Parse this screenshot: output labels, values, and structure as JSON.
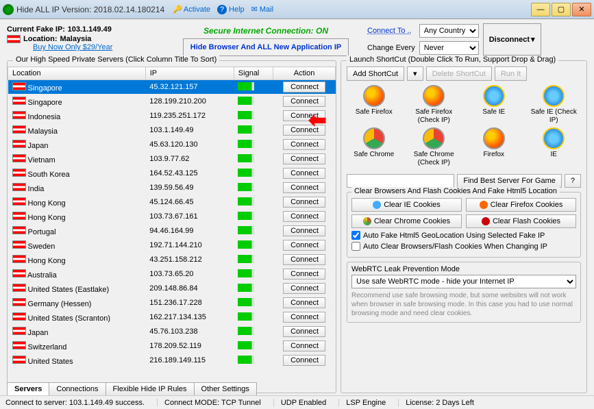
{
  "title": "Hide ALL IP   Version: 2018.02.14.180214",
  "menu": {
    "activate": "Activate",
    "help": "Help",
    "mail": "Mail"
  },
  "info": {
    "fakeip_label": "Current Fake IP:",
    "fakeip": "103.1.149.49",
    "location_label": "Location:",
    "location": "Malaysia",
    "buy": "Buy Now Only $29/Year"
  },
  "secure": "Secure Internet Connection: ON",
  "hide_button": "Hide Browser And ALL New Application IP",
  "connect": {
    "to_label": "Connect To ..",
    "to_value": "Any Country",
    "change_label": "Change Every",
    "change_value": "Never",
    "disconnect": "Disconnect"
  },
  "servers": {
    "title": "Our High Speed Private Servers (Click Column Title To Sort)",
    "cols": {
      "loc": "Location",
      "ip": "IP",
      "sig": "Signal",
      "act": "Action"
    },
    "connect_btn": "Connect",
    "rows": [
      {
        "loc": "Singapore",
        "ip": "45.32.121.157",
        "sel": true
      },
      {
        "loc": "Singapore",
        "ip": "128.199.210.200"
      },
      {
        "loc": "Indonesia",
        "ip": "119.235.251.172"
      },
      {
        "loc": "Malaysia",
        "ip": "103.1.149.49"
      },
      {
        "loc": "Japan",
        "ip": "45.63.120.130"
      },
      {
        "loc": "Vietnam",
        "ip": "103.9.77.62"
      },
      {
        "loc": "South Korea",
        "ip": "164.52.43.125"
      },
      {
        "loc": "India",
        "ip": "139.59.56.49"
      },
      {
        "loc": "Hong Kong",
        "ip": "45.124.66.45"
      },
      {
        "loc": "Hong Kong",
        "ip": "103.73.67.161"
      },
      {
        "loc": "Portugal",
        "ip": "94.46.164.99"
      },
      {
        "loc": "Sweden",
        "ip": "192.71.144.210"
      },
      {
        "loc": "Hong Kong",
        "ip": "43.251.158.212"
      },
      {
        "loc": "Australia",
        "ip": "103.73.65.20"
      },
      {
        "loc": "United States (Eastlake)",
        "ip": "209.148.86.84"
      },
      {
        "loc": "Germany (Hessen)",
        "ip": "151.236.17.228"
      },
      {
        "loc": "United States (Scranton)",
        "ip": "162.217.134.135"
      },
      {
        "loc": "Japan",
        "ip": "45.76.103.238"
      },
      {
        "loc": "Switzerland",
        "ip": "178.209.52.119"
      },
      {
        "loc": "United States",
        "ip": "216.189.149.115"
      }
    ]
  },
  "launch": {
    "title": "Launch ShortCut (Double Click To Run, Support Drop & Drag)",
    "add": "Add ShortCut",
    "del": "Delete ShortCut",
    "run": "Run It",
    "icons": [
      {
        "name": "Safe Firefox",
        "cls": "ff"
      },
      {
        "name": "Safe Firefox (Check IP)",
        "cls": "ff"
      },
      {
        "name": "Safe IE",
        "cls": "ie"
      },
      {
        "name": "Safe IE (Check IP)",
        "cls": "ie"
      },
      {
        "name": "Safe Chrome",
        "cls": "ch"
      },
      {
        "name": "Safe Chrome (Check IP)",
        "cls": "ch"
      },
      {
        "name": "Firefox",
        "cls": "ff"
      },
      {
        "name": "IE",
        "cls": "ie"
      }
    ],
    "find": "Find Best Server For Game",
    "q": "?"
  },
  "cookies": {
    "title": "Clear Browsers And Flash Cookies And Fake Html5 Location",
    "ie": "Clear IE Cookies",
    "ff": "Clear Firefox Cookies",
    "ch": "Clear Chrome Cookies",
    "fl": "Clear Flash Cookies",
    "auto_fake": "Auto Fake Html5 GeoLocation Using Selected Fake IP",
    "auto_clear": "Auto Clear Browsers/Flash Cookies When Changing IP"
  },
  "webrtc": {
    "title": "WebRTC Leak Prevention Mode",
    "value": "Use safe WebRTC mode - hide your Internet IP",
    "note": "Recommend use safe browsing mode, but some websites will not work when browser in safe browsing mode. In this case you had to use normal browsing mode and need clear cookies."
  },
  "tabs": [
    "Servers",
    "Connections",
    "Flexible Hide IP Rules",
    "Other Settings"
  ],
  "status": {
    "conn": "Connect to server: 103.1.149.49 success.",
    "mode": "Connect MODE: TCP Tunnel",
    "udp": "UDP Enabled",
    "lsp": "LSP Engine",
    "lic": "License: 2 Days Left"
  }
}
